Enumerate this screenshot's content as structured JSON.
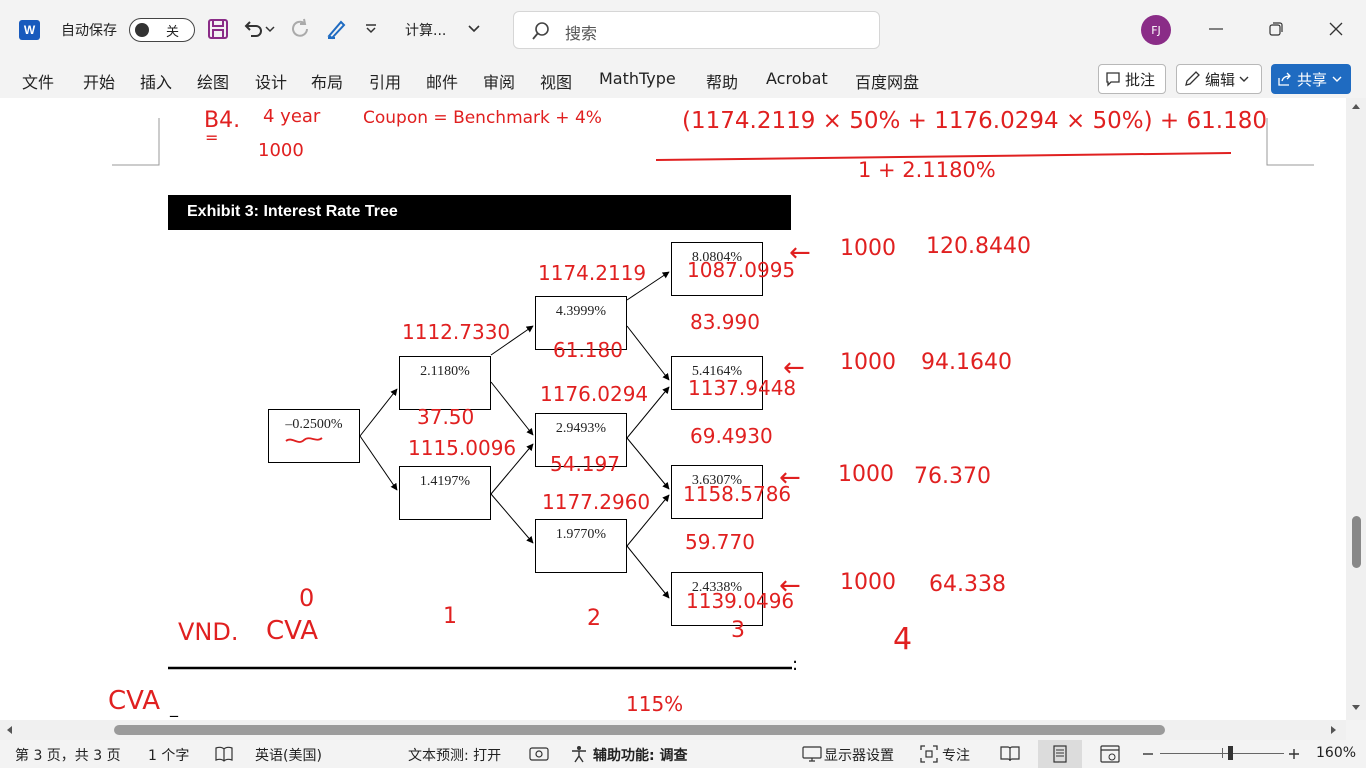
{
  "titlebar": {
    "app_icon": "word-icon",
    "autosave_label": "自动保存",
    "autosave_state": "关",
    "doc_title": "计算...",
    "search_placeholder": "搜索",
    "user_initials": "FJ"
  },
  "ribbon": {
    "tabs": [
      "文件",
      "开始",
      "插入",
      "绘图",
      "设计",
      "布局",
      "引用",
      "邮件",
      "审阅",
      "视图",
      "MathType",
      "帮助",
      "Acrobat",
      "百度网盘"
    ],
    "comment_label": "批注",
    "edit_label": "编辑",
    "share_label": "共享"
  },
  "document": {
    "exhibit_title": "Exhibit 3: Interest Rate Tree",
    "nodes": [
      "–0.2500%",
      "2.1180%",
      "1.4197%",
      "4.3999%",
      "2.9493%",
      "1.9770%",
      "8.0804%",
      "5.4164%",
      "3.6307%",
      "2.4338%"
    ],
    "annotations": {
      "b4": "B4.",
      "b4_eq": "=",
      "year": "4 year",
      "face": "1000",
      "coupon": "Coupon = Benchmark + 4%",
      "formula_num": "(1174.2119 × 50% + 1176.0294 × 50%) + 61.180",
      "formula_den": "1 + 2.1180%",
      "n_1112": "1112.7330",
      "n_3750": "37.50",
      "n_1115": "1115.0096",
      "n_1174": "1174.2119",
      "n_6118": "61.180",
      "n_1176": "1176.0294",
      "n_5419": "54.197",
      "n_1177": "1177.2960",
      "n_1087": "1087.0995",
      "n_8399": "83.990",
      "n_1137": "1137.9448",
      "n_6949": "69.4930",
      "n_1158": "1158.5786",
      "n_5977": "59.770",
      "n_1139": "1139.0496",
      "arrow": "←",
      "p1000": "1000",
      "r1": "120.8440",
      "r2": "94.1640",
      "r3": "76.370",
      "r4": "64.338",
      "t0": "0",
      "t1": "1",
      "t2": "2",
      "t3": "3",
      "t4": "4",
      "vnd": "VND.",
      "cva": "CVA",
      "cva2": "CVA",
      "dash": "_",
      "pct": "115%",
      "colon": ":"
    }
  },
  "statusbar": {
    "page_info": "第 3 页，共 3 页",
    "word_count": "1 个字",
    "language": "英语(美国)",
    "predict": "文本预测: 打开",
    "accessibility": "辅助功能: 调查",
    "display_settings": "显示器设置",
    "focus": "专注",
    "zoom": "160%"
  },
  "colors": {
    "ink": "#e02020",
    "accent": "#1f6bc1",
    "word_blue": "#185abd"
  }
}
